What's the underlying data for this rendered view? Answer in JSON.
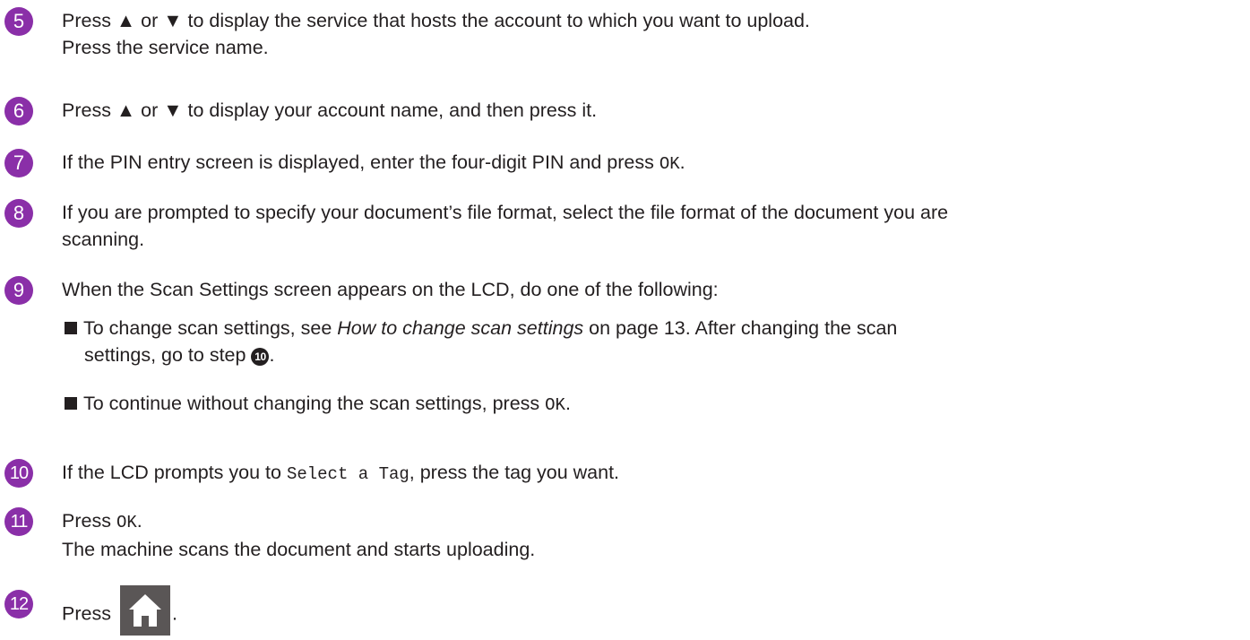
{
  "steps": [
    {
      "number": "5",
      "lines": [
        "Press ▲ or ▼ to display the service that hosts the account to which you want to upload.",
        "Press the service name."
      ]
    },
    {
      "number": "6",
      "text": "Press ▲ or ▼ to display your account name, and then press it."
    },
    {
      "number": "7",
      "text_before": "If the PIN entry screen is displayed, enter the four-digit PIN and press ",
      "code": "OK",
      "text_after": "."
    },
    {
      "number": "8",
      "lines": [
        "If you are prompted to specify your document’s file format, select the file format of the document you are",
        "scanning."
      ]
    },
    {
      "number": "9",
      "text": "When the Scan Settings screen appears on the LCD, do one of the following:",
      "bullets": [
        {
          "prefix": "To change scan settings, see ",
          "link": "How to change scan settings",
          "middle": " on page 13. After changing the scan",
          "line2": "settings, go to step ",
          "step_ref": "10",
          "suffix": "."
        },
        {
          "prefix": "To continue without changing the scan settings, press ",
          "code": "OK",
          "suffix": "."
        }
      ]
    },
    {
      "number": "10",
      "text_before": "If the LCD prompts you to ",
      "code": "Select a Tag",
      "text_after": ", press the tag you want."
    },
    {
      "number": "11",
      "text_before": "Press ",
      "code": "OK",
      "text_after": ".",
      "line2": "The machine scans the document and starts uploading."
    },
    {
      "number": "12",
      "text_before": "Press ",
      "icon": "home-icon",
      "text_after": "."
    }
  ],
  "colors": {
    "badge": "#8a2fa8",
    "text": "#231f20",
    "home_button": "#5a5656"
  }
}
